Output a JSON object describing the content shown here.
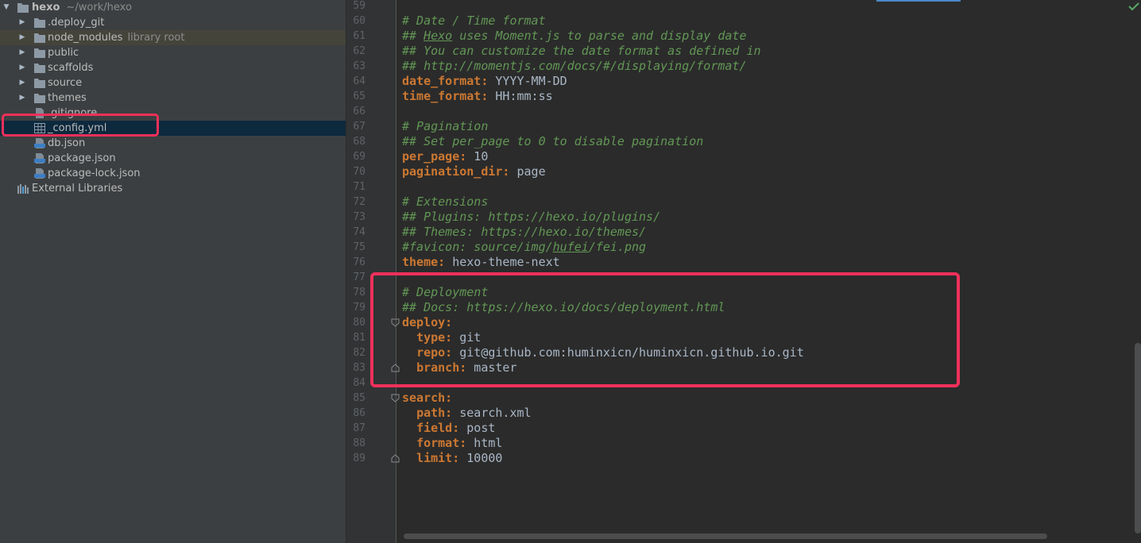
{
  "tree": {
    "root": {
      "name": "hexo",
      "path": "~/work/hexo"
    },
    "items": [
      {
        "label": "deploy_git_dot",
        "text": ".deploy_git",
        "kind": "folder"
      },
      {
        "text": "node_modules",
        "hint": "library root",
        "kind": "folder"
      },
      {
        "text": "public",
        "kind": "folder"
      },
      {
        "text": "scaffolds",
        "kind": "folder"
      },
      {
        "text": "source",
        "kind": "folder"
      },
      {
        "text": "themes",
        "kind": "folder"
      },
      {
        "text": ".gitignore",
        "kind": "file"
      },
      {
        "text": "_config.yml",
        "kind": "yml",
        "selected": true
      },
      {
        "text": "db.json",
        "kind": "json"
      },
      {
        "text": "package.json",
        "kind": "json"
      },
      {
        "text": "package-lock.json",
        "kind": "json"
      }
    ],
    "external": "External Libraries"
  },
  "editor": {
    "lines": [
      {
        "n": "59",
        "parts": []
      },
      {
        "n": "60",
        "parts": [
          {
            "t": "c",
            "s": "# Date / Time format"
          }
        ]
      },
      {
        "n": "61",
        "parts": [
          {
            "t": "c",
            "s": "## "
          },
          {
            "t": "cu",
            "s": "Hexo"
          },
          {
            "t": "c",
            "s": " uses Moment.js to parse and display date"
          }
        ]
      },
      {
        "n": "62",
        "parts": [
          {
            "t": "c",
            "s": "## You can customize the date format as defined in"
          }
        ]
      },
      {
        "n": "63",
        "parts": [
          {
            "t": "c",
            "s": "## http://momentjs.com/docs/#/displaying/format/"
          }
        ]
      },
      {
        "n": "64",
        "parts": [
          {
            "t": "k",
            "s": "date_format:"
          },
          {
            "t": "v",
            "s": " YYYY-MM-DD"
          }
        ]
      },
      {
        "n": "65",
        "parts": [
          {
            "t": "k",
            "s": "time_format:"
          },
          {
            "t": "v",
            "s": " HH:mm:ss"
          }
        ]
      },
      {
        "n": "66",
        "parts": []
      },
      {
        "n": "67",
        "parts": [
          {
            "t": "c",
            "s": "# Pagination"
          }
        ]
      },
      {
        "n": "68",
        "parts": [
          {
            "t": "c",
            "s": "## Set per_page to 0 to disable pagination"
          }
        ]
      },
      {
        "n": "69",
        "parts": [
          {
            "t": "k",
            "s": "per_page:"
          },
          {
            "t": "v",
            "s": " 10"
          }
        ]
      },
      {
        "n": "70",
        "parts": [
          {
            "t": "k",
            "s": "pagination_dir:"
          },
          {
            "t": "v",
            "s": " page"
          }
        ]
      },
      {
        "n": "71",
        "parts": []
      },
      {
        "n": "72",
        "parts": [
          {
            "t": "c",
            "s": "# Extensions"
          }
        ]
      },
      {
        "n": "73",
        "parts": [
          {
            "t": "c",
            "s": "## Plugins: https://hexo.io/plugins/"
          }
        ]
      },
      {
        "n": "74",
        "parts": [
          {
            "t": "c",
            "s": "## Themes: https://hexo.io/themes/"
          }
        ]
      },
      {
        "n": "75",
        "parts": [
          {
            "t": "c",
            "s": "#favicon: source/img/"
          },
          {
            "t": "cu",
            "s": "hufei"
          },
          {
            "t": "c",
            "s": "/fei.png"
          }
        ]
      },
      {
        "n": "76",
        "parts": [
          {
            "t": "k",
            "s": "theme:"
          },
          {
            "t": "v",
            "s": " hexo-theme-next"
          }
        ]
      },
      {
        "n": "77",
        "parts": []
      },
      {
        "n": "78",
        "parts": [
          {
            "t": "c",
            "s": "# Deployment"
          }
        ]
      },
      {
        "n": "79",
        "parts": [
          {
            "t": "c",
            "s": "## Docs: https://hexo.io/docs/deployment.html"
          }
        ]
      },
      {
        "n": "80",
        "fold": "open",
        "parts": [
          {
            "t": "k",
            "s": "deploy:"
          }
        ]
      },
      {
        "n": "81",
        "parts": [
          {
            "t": "v",
            "s": "  "
          },
          {
            "t": "k",
            "s": "type:"
          },
          {
            "t": "v",
            "s": " git"
          }
        ]
      },
      {
        "n": "82",
        "parts": [
          {
            "t": "v",
            "s": "  "
          },
          {
            "t": "k",
            "s": "repo:"
          },
          {
            "t": "v",
            "s": " git@github.com:huminxicn/huminxicn.github.io.git"
          }
        ]
      },
      {
        "n": "83",
        "fold": "close",
        "parts": [
          {
            "t": "v",
            "s": "  "
          },
          {
            "t": "k",
            "s": "branch:"
          },
          {
            "t": "v",
            "s": " master"
          }
        ]
      },
      {
        "n": "84",
        "parts": []
      },
      {
        "n": "85",
        "fold": "open",
        "parts": [
          {
            "t": "k",
            "s": "search:"
          }
        ]
      },
      {
        "n": "86",
        "parts": [
          {
            "t": "v",
            "s": "  "
          },
          {
            "t": "k",
            "s": "path:"
          },
          {
            "t": "v",
            "s": " search.xml"
          }
        ]
      },
      {
        "n": "87",
        "parts": [
          {
            "t": "v",
            "s": "  "
          },
          {
            "t": "k",
            "s": "field:"
          },
          {
            "t": "v",
            "s": " post"
          }
        ]
      },
      {
        "n": "88",
        "parts": [
          {
            "t": "v",
            "s": "  "
          },
          {
            "t": "k",
            "s": "format:"
          },
          {
            "t": "v",
            "s": " html"
          }
        ]
      },
      {
        "n": "89",
        "fold": "close",
        "parts": [
          {
            "t": "v",
            "s": "  "
          },
          {
            "t": "k",
            "s": "limit:"
          },
          {
            "t": "v",
            "s": " 10000"
          }
        ]
      }
    ]
  },
  "colors": {
    "highlight": "#f0305a",
    "comment": "#629755",
    "key": "#cc7832",
    "text": "#a9b7c6",
    "selection": "#0d293e"
  }
}
